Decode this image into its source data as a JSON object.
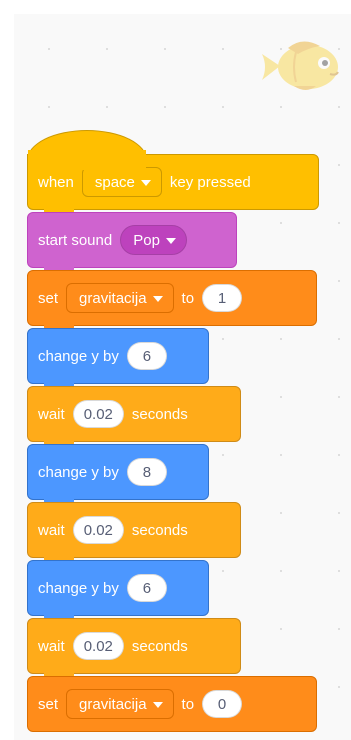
{
  "blocks": [
    {
      "type": "hat",
      "category": "events",
      "prefix": "when",
      "dropdown": "space",
      "suffix": "key pressed"
    },
    {
      "type": "sound",
      "category": "sound",
      "label": "start sound",
      "dropdown": "Pop"
    },
    {
      "type": "set-var",
      "category": "variables",
      "prefix": "set",
      "dropdown": "gravitacija",
      "mid": "to",
      "value": "1"
    },
    {
      "type": "change-y",
      "category": "motion",
      "label": "change y by",
      "value": "6"
    },
    {
      "type": "wait",
      "category": "control",
      "prefix": "wait",
      "value": "0.02",
      "suffix": "seconds"
    },
    {
      "type": "change-y",
      "category": "motion",
      "label": "change y by",
      "value": "8"
    },
    {
      "type": "wait",
      "category": "control",
      "prefix": "wait",
      "value": "0.02",
      "suffix": "seconds"
    },
    {
      "type": "change-y",
      "category": "motion",
      "label": "change y by",
      "value": "6"
    },
    {
      "type": "wait",
      "category": "control",
      "prefix": "wait",
      "value": "0.02",
      "suffix": "seconds"
    },
    {
      "type": "set-var",
      "category": "variables",
      "prefix": "set",
      "dropdown": "gravitacija",
      "mid": "to",
      "value": "0"
    }
  ],
  "colors": {
    "events": "#FFBF00",
    "sound": "#CF63CF",
    "variables": "#FF8C1A",
    "motion": "#4C97FF",
    "control": "#FFAB19"
  },
  "sprite": {
    "icon": "fish-sprite-icon"
  }
}
